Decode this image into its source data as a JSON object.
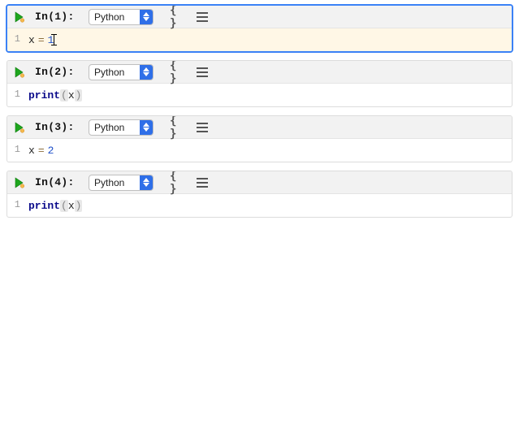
{
  "language_label": "Python",
  "braces_label": "{ }",
  "cells": [
    {
      "prompt": "In(1):",
      "active": true,
      "gutter": "1",
      "tokens": {
        "var": "x",
        "op": "=",
        "val": "1"
      },
      "has_cursor": true,
      "type": "assign"
    },
    {
      "prompt": "In(2):",
      "active": false,
      "gutter": "1",
      "tokens": {
        "fn": "print",
        "arg": "x"
      },
      "type": "call"
    },
    {
      "prompt": "In(3):",
      "active": false,
      "gutter": "1",
      "tokens": {
        "var": "x",
        "op": "=",
        "val": "2"
      },
      "type": "assign"
    },
    {
      "prompt": "In(4):",
      "active": false,
      "gutter": "1",
      "tokens": {
        "fn": "print",
        "arg": "x"
      },
      "type": "call"
    }
  ]
}
